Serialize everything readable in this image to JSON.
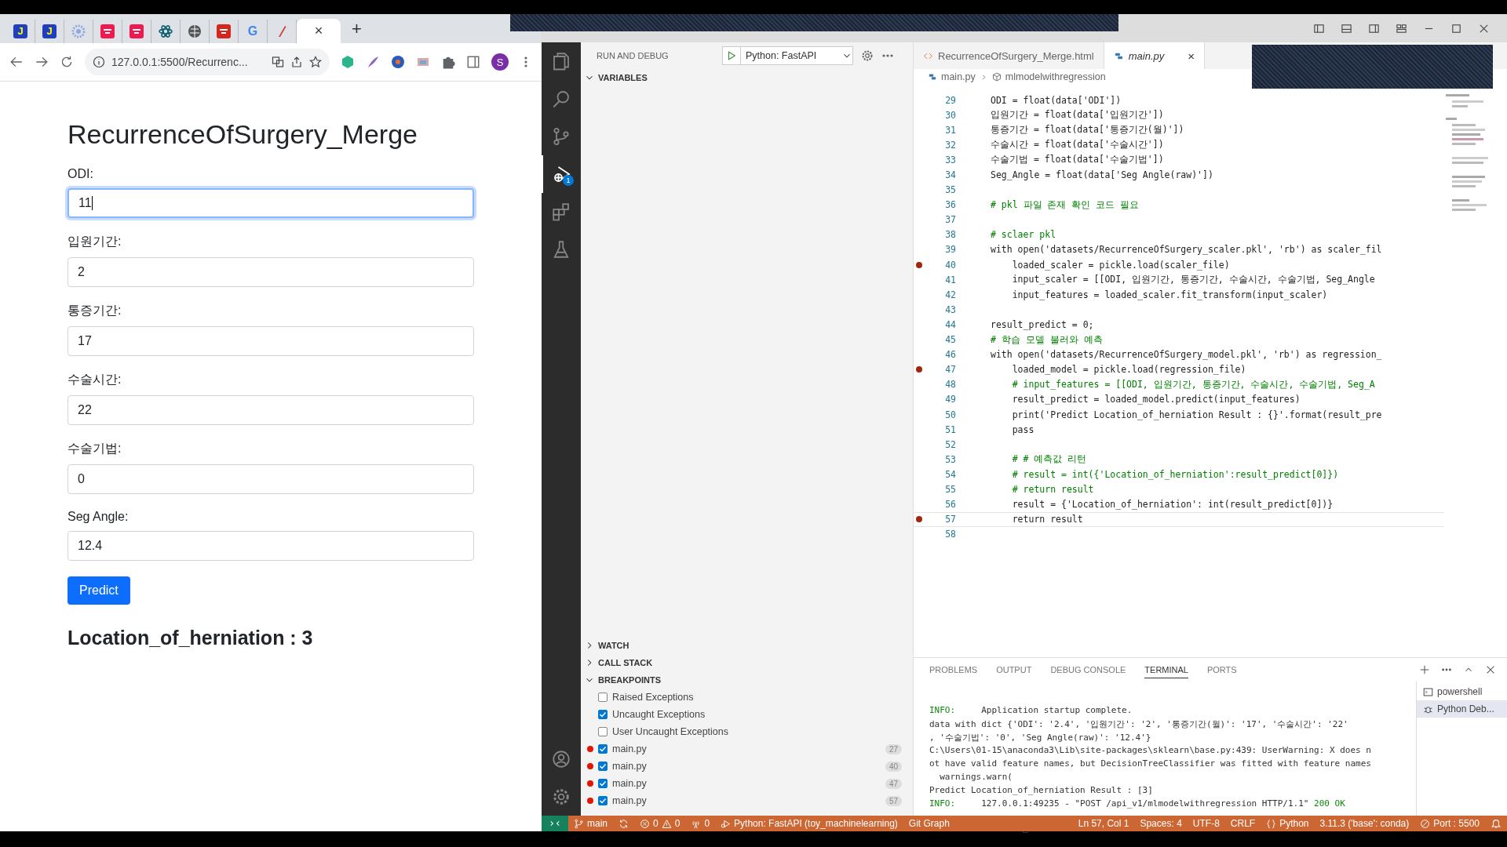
{
  "browser": {
    "tabs": [
      {
        "kind": "letter",
        "label": "J",
        "color": "#1f3fbf",
        "selected": false
      },
      {
        "kind": "letter",
        "label": "J",
        "color": "#1f3fbf",
        "selected": false
      },
      {
        "kind": "gear",
        "color": "#8fa8e0",
        "selected": false
      },
      {
        "kind": "logo",
        "color": "#f0194f",
        "selected": false
      },
      {
        "kind": "logo",
        "color": "#f0194f",
        "selected": false
      },
      {
        "kind": "atom",
        "color": "#0f5f6f",
        "selected": false
      },
      {
        "kind": "globe",
        "color": "#555555",
        "selected": false
      },
      {
        "kind": "logo",
        "color": "#d3261d",
        "selected": false
      },
      {
        "kind": "letter",
        "label": "G",
        "color": "#4285f4",
        "selected": false
      },
      {
        "kind": "pen",
        "color": "#d23b3b",
        "selected": false
      },
      {
        "kind": "blank",
        "close": "×",
        "selected": true
      }
    ],
    "new_tab": "+",
    "url": "127.0.0.1:5500/Recurrenc...",
    "profile": "S"
  },
  "page": {
    "title": "RecurrenceOfSurgery_Merge",
    "fields": [
      {
        "label": "ODI:",
        "value": "11",
        "focused": true
      },
      {
        "label": "입원기간:",
        "value": "2",
        "focused": false
      },
      {
        "label": "통증기간:",
        "value": "17",
        "focused": false
      },
      {
        "label": "수술시간:",
        "value": "22",
        "focused": false
      },
      {
        "label": "수술기법:",
        "value": "0",
        "focused": false
      },
      {
        "label": "Seg Angle:",
        "value": "12.4",
        "focused": false
      }
    ],
    "button": "Predict",
    "result": "Location_of_herniation : 3"
  },
  "activity": [
    {
      "kind": "files",
      "selected": false
    },
    {
      "kind": "search",
      "selected": false
    },
    {
      "kind": "branch",
      "selected": false
    },
    {
      "kind": "debug",
      "selected": true,
      "badge": "1"
    },
    {
      "kind": "extensions",
      "selected": false
    },
    {
      "kind": "flask",
      "selected": false
    }
  ],
  "activity_bottom": [
    {
      "kind": "account"
    },
    {
      "kind": "gear"
    }
  ],
  "sidebar": {
    "title": "RUN AND DEBUG",
    "config": "Python: FastAPI",
    "sections": [
      {
        "label": "VARIABLES",
        "expanded": true
      },
      {
        "label": "WATCH",
        "expanded": false
      },
      {
        "label": "CALL STACK",
        "expanded": false
      },
      {
        "label": "BREAKPOINTS",
        "expanded": true
      }
    ],
    "breakpoints": [
      {
        "kind": "exception",
        "label": "Raised Exceptions",
        "checked": false
      },
      {
        "kind": "exception",
        "label": "Uncaught Exceptions",
        "checked": true
      },
      {
        "kind": "exception",
        "label": "User Uncaught Exceptions",
        "checked": false
      },
      {
        "kind": "file",
        "label": "main.py",
        "checked": true,
        "line": "27"
      },
      {
        "kind": "file",
        "label": "main.py",
        "checked": true,
        "line": "40"
      },
      {
        "kind": "file",
        "label": "main.py",
        "checked": true,
        "line": "47"
      },
      {
        "kind": "file",
        "label": "main.py",
        "checked": true,
        "line": "57"
      }
    ]
  },
  "editor": {
    "tabs": [
      {
        "kind": "html",
        "label": "RecurrenceOfSurgery_Merge.html",
        "selected": false
      },
      {
        "kind": "python",
        "label": "main.py",
        "selected": true,
        "close": "×"
      }
    ],
    "breadcrumb": [
      "main.py",
      "mlmodelwithregression"
    ],
    "lines": [
      {
        "number": "29",
        "kind": "code",
        "text": "ODI = float(data['ODI'])",
        "breakpoint": false,
        "current": false
      },
      {
        "number": "30",
        "kind": "code",
        "text": "입원기간 = float(data['입원기간'])",
        "breakpoint": false,
        "current": false
      },
      {
        "number": "31",
        "kind": "code",
        "text": "통증기간 = float(data['통증기간(월)'])",
        "breakpoint": false,
        "current": false
      },
      {
        "number": "32",
        "kind": "code",
        "text": "수술시간 = float(data['수술시간'])",
        "breakpoint": false,
        "current": false
      },
      {
        "number": "33",
        "kind": "code",
        "text": "수술기법 = float(data['수술기법'])",
        "breakpoint": false,
        "current": false
      },
      {
        "number": "34",
        "kind": "code",
        "text": "Seg_Angle = float(data['Seg Angle(raw)'])",
        "breakpoint": false,
        "current": false
      },
      {
        "number": "35",
        "kind": "blank",
        "breakpoint": false,
        "current": false
      },
      {
        "number": "36",
        "kind": "comment",
        "text": "# pkl 파일 존재 확인 코드 필요",
        "breakpoint": false,
        "current": false
      },
      {
        "number": "37",
        "kind": "blank",
        "breakpoint": false,
        "current": false
      },
      {
        "number": "38",
        "kind": "comment",
        "text": "# sclaer pkl",
        "breakpoint": false,
        "current": false
      },
      {
        "number": "39",
        "kind": "code",
        "text": "with open('datasets/RecurrenceOfSurgery_scaler.pkl', 'rb') as scaler_fil",
        "breakpoint": false,
        "current": false
      },
      {
        "number": "40",
        "kind": "code",
        "text": "    loaded_scaler = pickle.load(scaler_file)",
        "breakpoint": true,
        "current": false
      },
      {
        "number": "41",
        "kind": "code",
        "text": "    input_scaler = [[ODI, 입원기간, 통증기간, 수술시간, 수술기법, Seg_Angle",
        "breakpoint": false,
        "current": false
      },
      {
        "number": "42",
        "kind": "code",
        "text": "    input_features = loaded_scaler.fit_transform(input_scaler)",
        "breakpoint": false,
        "current": false
      },
      {
        "number": "43",
        "kind": "blank",
        "breakpoint": false,
        "current": false
      },
      {
        "number": "44",
        "kind": "code",
        "text": "result_predict = 0;",
        "breakpoint": false,
        "current": false
      },
      {
        "number": "45",
        "kind": "comment",
        "text": "# 학습 모델 불러와 예측",
        "breakpoint": false,
        "current": false
      },
      {
        "number": "46",
        "kind": "code",
        "text": "with open('datasets/RecurrenceOfSurgery_model.pkl', 'rb') as regression_",
        "breakpoint": false,
        "current": false
      },
      {
        "number": "47",
        "kind": "code",
        "text": "    loaded_model = pickle.load(regression_file)",
        "breakpoint": true,
        "current": false
      },
      {
        "number": "48",
        "kind": "comment",
        "text": "    # input_features = [[ODI, 입원기간, 통증기간, 수술시간, 수술기법, Seg_A",
        "breakpoint": false,
        "current": false
      },
      {
        "number": "49",
        "kind": "code",
        "text": "    result_predict = loaded_model.predict(input_features)",
        "breakpoint": false,
        "current": false
      },
      {
        "number": "50",
        "kind": "code",
        "text": "    print('Predict Location_of_herniation Result : {}'.format(result_pre",
        "breakpoint": false,
        "current": false
      },
      {
        "number": "51",
        "kind": "code",
        "text": "    pass",
        "breakpoint": false,
        "current": false
      },
      {
        "number": "52",
        "kind": "blank",
        "breakpoint": false,
        "current": false
      },
      {
        "number": "53",
        "kind": "comment",
        "text": "    # # 예측값 리턴",
        "breakpoint": false,
        "current": false
      },
      {
        "number": "54",
        "kind": "comment",
        "text": "    # result = int({'Location_of_herniation':result_predict[0]})",
        "breakpoint": false,
        "current": false
      },
      {
        "number": "55",
        "kind": "comment",
        "text": "    # return result",
        "breakpoint": false,
        "current": false
      },
      {
        "number": "56",
        "kind": "code",
        "text": "    result = {'Location_of_herniation': int(result_predict[0])}",
        "breakpoint": false,
        "current": false
      },
      {
        "number": "57",
        "kind": "code",
        "text": "    return result",
        "breakpoint": true,
        "current": true
      },
      {
        "number": "58",
        "kind": "blank",
        "breakpoint": false,
        "current": false
      }
    ]
  },
  "panel": {
    "tabs": [
      {
        "label": "PROBLEMS",
        "selected": false
      },
      {
        "label": "OUTPUT",
        "selected": false
      },
      {
        "label": "DEBUG CONSOLE",
        "selected": false
      },
      {
        "label": "TERMINAL",
        "selected": true
      },
      {
        "label": "PORTS",
        "selected": false
      }
    ],
    "terminal": [
      {
        "label": "INFO:",
        "text": "Application startup complete."
      },
      {
        "text": "data with dict {'ODI': '2.4', '입원기간': '2', '통증기간(월)': '17', '수술시간': '22'"
      },
      {
        "text": ", '수술기법': '0', 'Seg Angle(raw)': '12.4'}"
      },
      {
        "text": "C:\\Users\\01-15\\anaconda3\\Lib\\site-packages\\sklearn\\base.py:439: UserWarning: X does n"
      },
      {
        "text": "ot have valid feature names, but DecisionTreeClassifier was fitted with feature names"
      },
      {
        "text": "  warnings.warn("
      },
      {
        "text": "Predict Location_of_herniation Result : [3]"
      },
      {
        "label": "INFO:",
        "text": "127.0.0.1:49235 - \"POST /api_v1/mlmodelwithregression HTTP/1.1\"",
        "status": "200 OK"
      }
    ],
    "terminals": [
      {
        "kind": "shell",
        "label": "powershell",
        "selected": false
      },
      {
        "kind": "debug",
        "label": "Python Deb...",
        "selected": true
      }
    ]
  },
  "status_bar": {
    "left": [
      {
        "kind": "remote"
      },
      {
        "kind": "branch",
        "text": "main"
      },
      {
        "kind": "sync"
      },
      {
        "kind": "problems",
        "errors": "0",
        "warnings": "0"
      },
      {
        "kind": "ports",
        "text": "0"
      },
      {
        "kind": "debug",
        "text": "Python: FastAPI (toy_machinelearning)"
      },
      {
        "kind": "plain",
        "text": "Git Graph"
      }
    ],
    "right": [
      {
        "kind": "plain",
        "text": "Ln 57, Col 1"
      },
      {
        "kind": "plain",
        "text": "Spaces: 4"
      },
      {
        "kind": "plain",
        "text": "UTF-8"
      },
      {
        "kind": "plain",
        "text": "CRLF"
      },
      {
        "kind": "language",
        "text": "Python"
      },
      {
        "kind": "plain",
        "text": "3.11.3 ('base': conda)"
      },
      {
        "kind": "port",
        "text": "Port : 5500"
      },
      {
        "kind": "bell"
      }
    ]
  }
}
